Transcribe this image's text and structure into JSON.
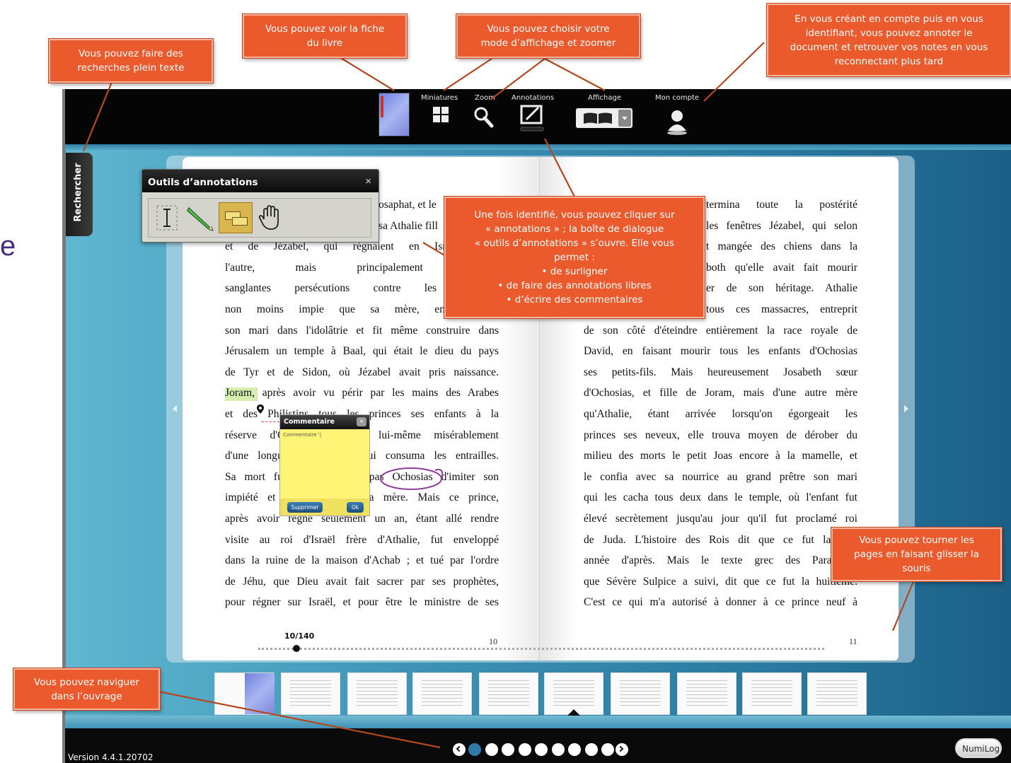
{
  "app": {
    "version": "Version 4.4.1.20702",
    "brand": "NumiLog",
    "side_tab": "Rechercher",
    "stray_letter": "e"
  },
  "toolbar": {
    "miniatures": "Miniatures",
    "zoom": "Zoom",
    "annotations": "Annotations",
    "affichage": "Affichage",
    "mon_compte": "Mon compte"
  },
  "annotation_tools": {
    "title": "Outils d’annotations",
    "close": "×",
    "tools": [
      "text-select-icon",
      "pencil-icon",
      "highlight-comment-icon",
      "hand-icon"
    ]
  },
  "comment_box": {
    "title": "Commentaire",
    "text": "Commentaire '|",
    "delete_label": "Supprimer",
    "ok_label": "Ok"
  },
  "book": {
    "left_page_number": "10",
    "right_page_number": "11",
    "progress": "10/140",
    "left_lines": [
      "osaphat, et le",
      "sa Athalie fill",
      "et de Jézabel, qui régnaient en Israël, fame",
      "l'autre, mais principalement Jézabel,",
      "sanglantes persécutions contre les prophète",
      "non moins impie que sa mère, entraîna bie",
      "son mari dans l'idolâtrie et fit même construire dans",
      "Jérusalem un temple à Baal, qui était le dieu du pays",
      "de Tyr et de Sidon, où Jézabel avait pris naissance.",
      "Joram, après avoir vu périr par les mains des Arabes",
      "et des Philistins tous les princes ses enfants à la",
      "réserve d'Ochosias, mourut lui-même misérablement",
      "d'une longue maladie qui lui consuma les entrailles.",
      "Sa mort funeste n'empêcha pas Ochosias d'imiter son",
      "impiété et celle d'Athalie sa mère. Mais ce prince,",
      "après avoir régné seulement un an, étant allé rendre",
      "visite au roi d'Israël frère d'Athalie, fut enveloppé",
      "dans la ruine de la maison d'Achab ; et tué par l'ordre",
      "de Jéhu, que Dieu avait fait sacrer par ses prophètes,",
      "pour régner sur Israël, et pour être le ministre de ses"
    ],
    "right_lines": [
      "termina toute la postérité",
      "les fenêtres Jézabel, qui selon",
      "t mangée des chiens dans la",
      "both qu'elle avait fait mourir",
      "er de son héritage. Athalie",
      "tous ces massacres, entreprit",
      "de son côté d'éteindre entièrement la race royale de",
      "David, en faisant mourir tous les enfants d'Ochosias",
      "ses petits-fils. Mais heureusement Josabeth sœur",
      "d'Ochosias, et fille de Joram, mais d'une autre mère",
      "qu'Athalie, étant arrivée lorsqu'on égorgeait les",
      "princes ses neveux, elle trouva moyen de dérober du",
      "milieu des morts le petit Joas encore à la mamelle, et",
      "le confia avec sa nourrice au grand prêtre son mari",
      "qui les cacha tous deux dans le temple, où l'enfant fut",
      "élevé secrètement jusqu'au jour qu'il fut proclamé roi",
      "de Juda. L'histoire des Rois dit que ce fut la sept",
      "année d'après. Mais le texte grec des Paralipom",
      "que Sévère Sulpice a suivi, dit que ce fut la huitième.",
      "C'est ce qui m'a autorisé à donner à ce prince neuf à"
    ]
  },
  "callouts": {
    "search": "Vous pouvez  faire des\nrecherches plein texte",
    "fiche": "Vous pouvez  voir la fiche\ndu livre",
    "affichage": "Vous pouvez choisir votre\nmode d’affichage et zoomer",
    "compte": "En vous créant en compte puis en vous\nidentifiant, vous pouvez annoter le\ndocument et retrouver vos notes en vous\nreconnectant plus tard",
    "annotations": "Une fois identifié, vous pouvez cliquer sur\n« annotations » ; la boîte de dialogue\n« outils d’annotations » s’ouvre. Elle vous\npermet :\n• de surligner\n• de faire des annotations libres\n• d’écrire des commentaires",
    "tourner": "Vous pouvez  tourner les\npages en faisant glisser la\nsouris",
    "naviguer": "Vous pouvez  naviguer\ndans l’ouvrage"
  },
  "pager": {
    "pages": 9,
    "active": 1
  },
  "colors": {
    "callout": "#ea5a2c",
    "toolbar": "#050505",
    "app_bg": "#3b90b3",
    "highlight": "#d6efb0",
    "comment": "#fff475",
    "circle": "#8e3a9a"
  }
}
